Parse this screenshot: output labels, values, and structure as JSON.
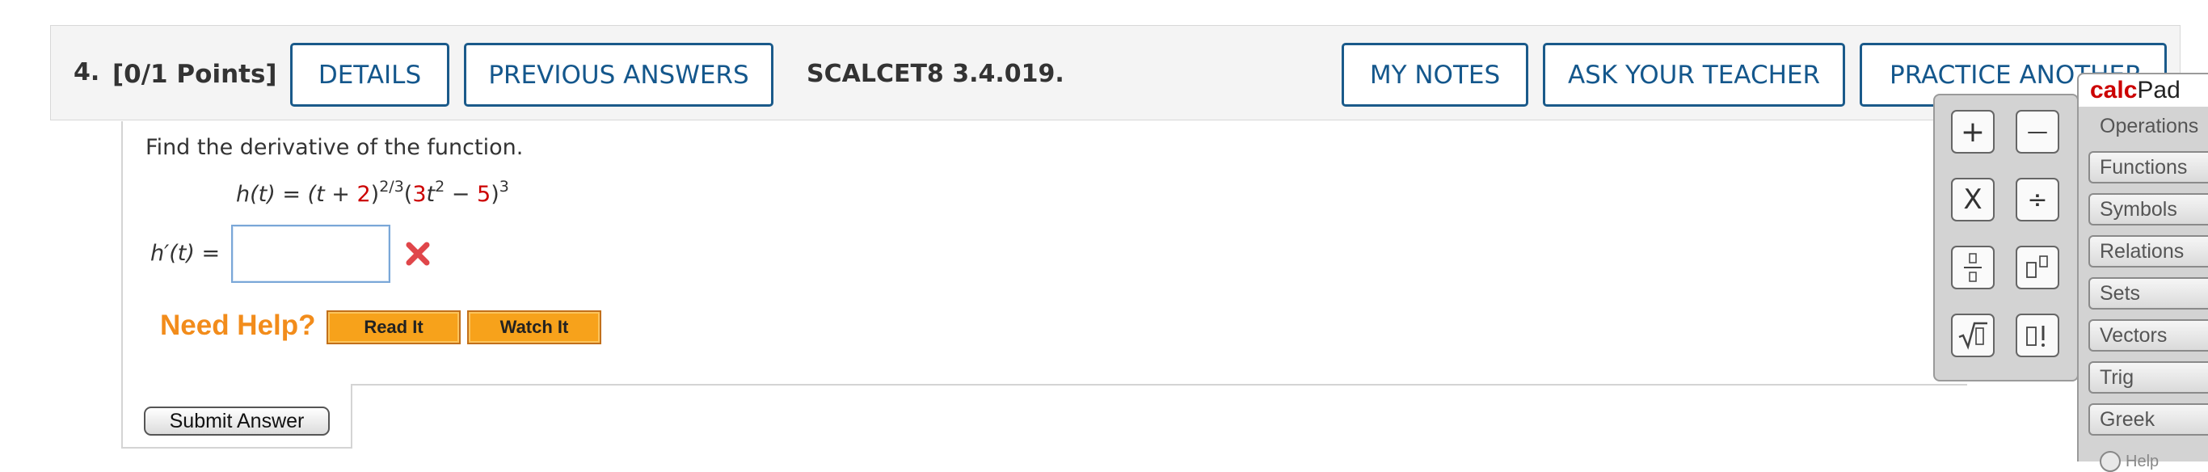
{
  "question": {
    "number": "4.",
    "points": "[0/1 Points]",
    "code": "SCALCET8 3.4.019.",
    "buttons": {
      "details": "DETAILS",
      "previous_answers": "PREVIOUS ANSWERS",
      "my_notes": "MY NOTES",
      "ask_teacher": "ASK YOUR TEACHER",
      "practice_another": "PRACTICE ANOTHER"
    }
  },
  "problem": {
    "prompt": "Find the derivative of the function.",
    "formula": {
      "lhs": "h(t) = (t + ",
      "c1": "2",
      "exp1": "2/3",
      "open": "(",
      "c2": "3",
      "t2": "t",
      "exp2": "2",
      "minus": " − ",
      "c3": "5",
      "close": ")",
      "exp3": "3"
    },
    "answer_label": "h′(t) =",
    "answer_value": "",
    "status": "incorrect"
  },
  "help": {
    "label": "Need Help?",
    "read_it": "Read It",
    "watch_it": "Watch It"
  },
  "submit_label": "Submit Answer",
  "calcpad": {
    "title_red": "calc",
    "title_black": "Pad",
    "keys": [
      "+",
      "—",
      "X",
      "÷",
      "fraction",
      "power",
      "√▯",
      "▯!"
    ],
    "tabs": [
      "Operations",
      "Functions",
      "Symbols",
      "Relations",
      "Sets",
      "Vectors",
      "Trig",
      "Greek"
    ],
    "help_label": "Help"
  },
  "colors": {
    "accent_blue": "#14578c",
    "need_help_orange": "#f28c1b",
    "error_red": "#e0464a",
    "constant_red": "#cc0000"
  }
}
